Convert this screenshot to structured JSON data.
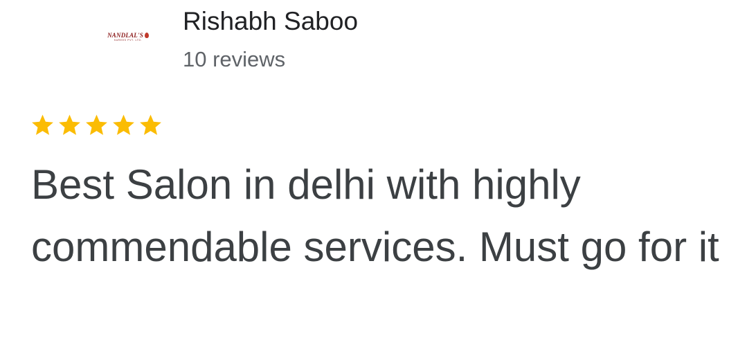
{
  "reviewer": {
    "name": "Rishabh Saboo",
    "review_count": "10 reviews",
    "avatar_logo_text": "NANDLAL'S",
    "avatar_logo_subtext": "SAREES PVT. LTD."
  },
  "rating": {
    "stars": 5,
    "max_stars": 5,
    "star_color": "#fbbc04",
    "icon": "star-icon"
  },
  "review": {
    "text": "Best Salon in delhi with highly commendable services. Must go for it"
  }
}
